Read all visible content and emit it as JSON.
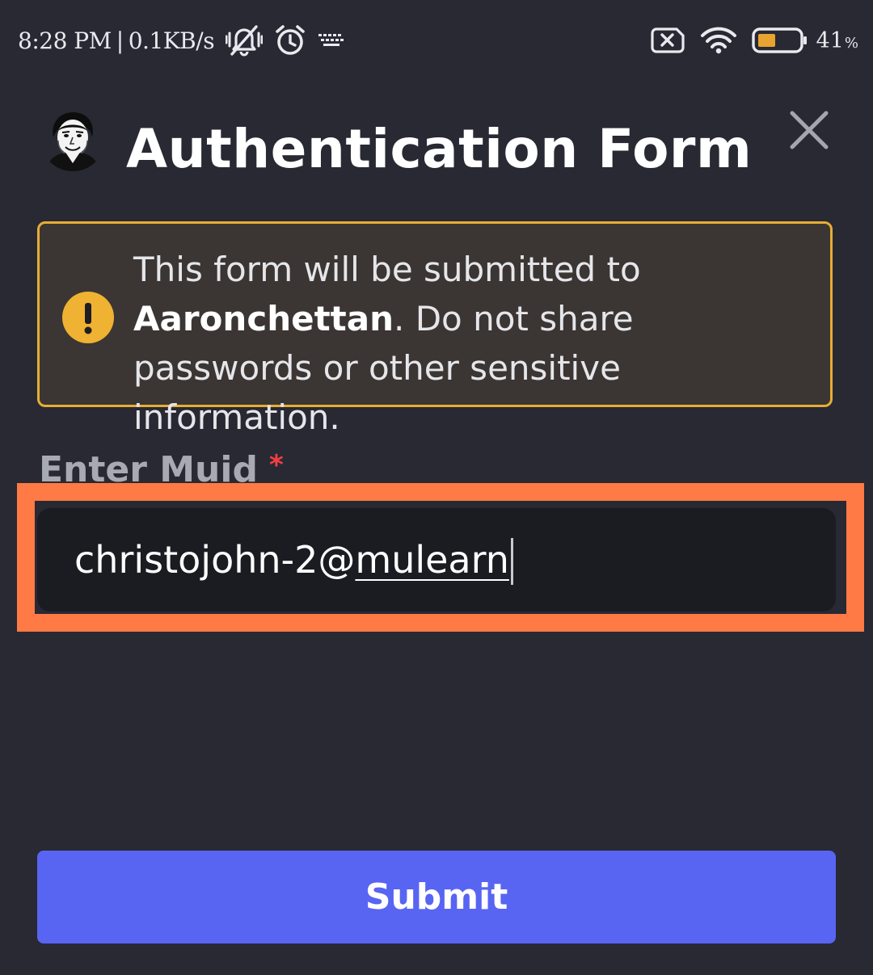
{
  "status_bar": {
    "time": "8:28 PM",
    "separator": "|",
    "network_speed": "0.1KB/s",
    "left_icons": [
      "mute-vibrate-icon",
      "alarm-icon",
      "keyboard-icon"
    ],
    "right_icons": [
      "sim-none-icon",
      "wifi-icon",
      "battery-icon"
    ],
    "battery_level": 41,
    "battery_percent": "41",
    "battery_percent_sign": "%",
    "battery_color": "#e8a330"
  },
  "header": {
    "title": "Authentication Form",
    "avatar_icon": "avatar-portrait",
    "close_icon": "close-icon"
  },
  "warning": {
    "icon": "exclamation-icon",
    "text_before": "This form will be submitted to ",
    "app_name": "Aaronchettan",
    "text_after": ". Do not share passwords or other sensitive information.",
    "border_color": "#e6ae35",
    "icon_color": "#f0b232"
  },
  "field": {
    "label": "Enter Muid",
    "required_mark": "*",
    "value_prefix": "christojohn-2@",
    "value_suffix": "mulearn",
    "highlight_color": "#ff7a45"
  },
  "submit": {
    "label": "Submit",
    "color": "#5865f2"
  },
  "theme": {
    "background": "#282933",
    "input_background": "#1b1b22",
    "required_color": "#f23f43"
  }
}
